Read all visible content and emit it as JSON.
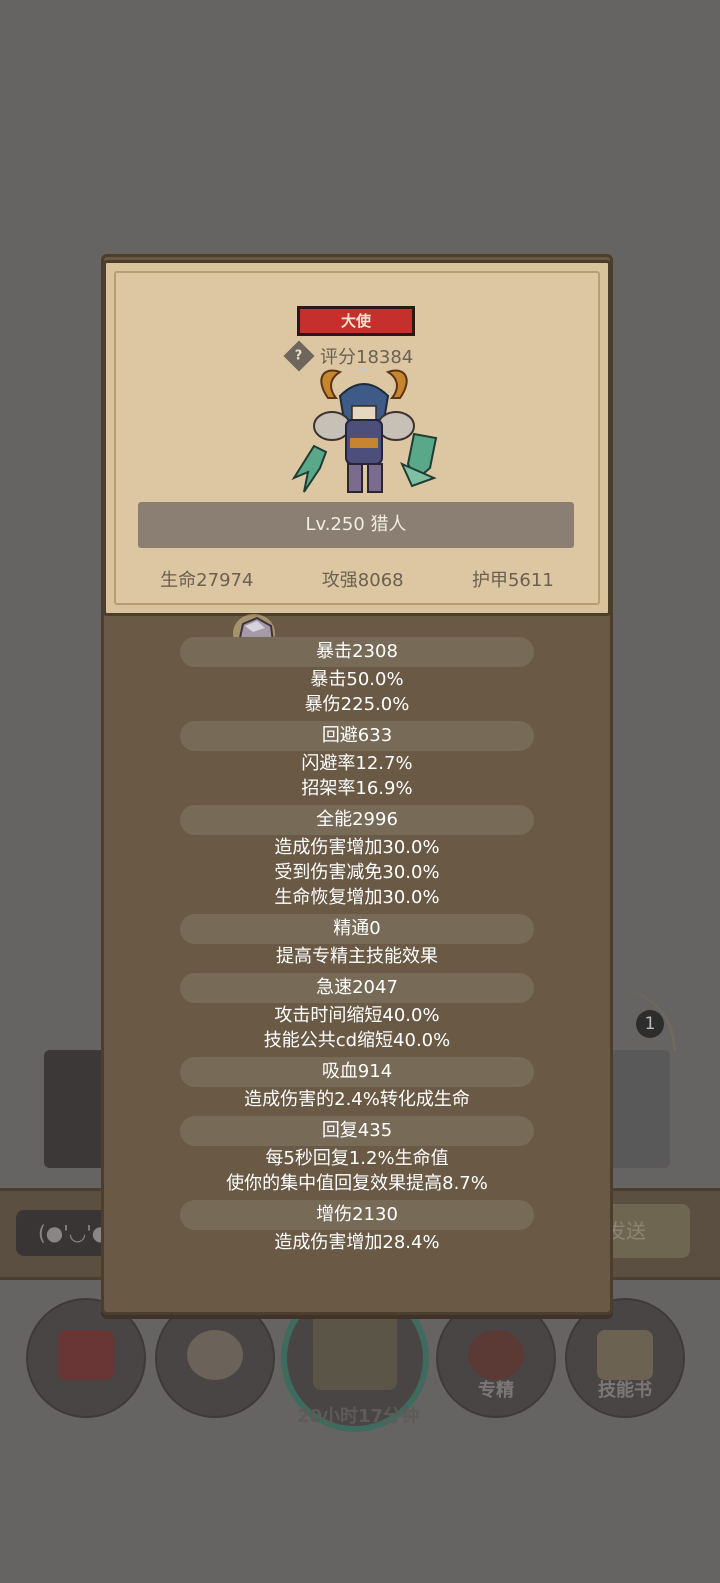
{
  "background": {
    "badge_count": "1",
    "chat_input_text": "(●'◡'●",
    "send_button_label": "发送",
    "bottom_buttons": [
      {
        "label": ""
      },
      {
        "label": ""
      },
      {
        "label": ""
      },
      {
        "label": "专精"
      },
      {
        "label": "技能书"
      }
    ],
    "timer_text": "20小时17分钟"
  },
  "hero": {
    "rank_label": "大使",
    "score_label": "评分18384",
    "name_label": "Lv.250 猎人",
    "stats": {
      "hp": "生命27974",
      "attack": "攻强8068",
      "armor": "护甲5611"
    }
  },
  "attributes": [
    {
      "header": "暴击2308",
      "lines": [
        "暴击50.0%",
        "暴伤225.0%"
      ]
    },
    {
      "header": "回避633",
      "lines": [
        "闪避率12.7%",
        "招架率16.9%"
      ]
    },
    {
      "header": "全能2996",
      "lines": [
        "造成伤害增加30.0%",
        "受到伤害减免30.0%",
        "生命恢复增加30.0%"
      ]
    },
    {
      "header": "精通0",
      "lines": [
        "提高专精主技能效果"
      ]
    },
    {
      "header": "急速2047",
      "lines": [
        "攻击时间缩短40.0%",
        "技能公共cd缩短40.0%"
      ]
    },
    {
      "header": "吸血914",
      "lines": [
        "造成伤害的2.4%转化成生命"
      ]
    },
    {
      "header": "回复435",
      "lines": [
        "每5秒回复1.2%生命值",
        "使你的集中值回复效果提高8.7%"
      ]
    },
    {
      "header": "增伤2130",
      "lines": [
        "造成伤害增加28.4%"
      ]
    }
  ]
}
